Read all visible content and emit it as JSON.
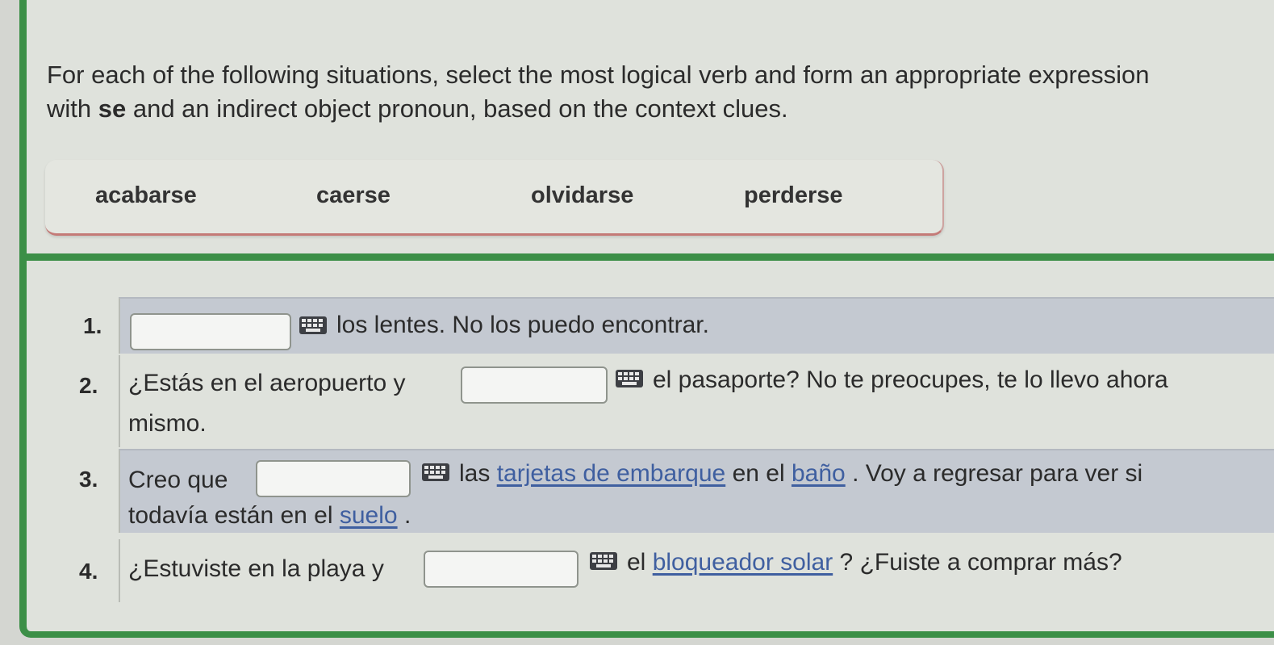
{
  "instructions": {
    "line1": "For each of the following situations, select the most logical verb and form an appropriate expression",
    "line2_pre": "with ",
    "line2_bold": "se",
    "line2_post": " and an indirect object pronoun, based on the context clues."
  },
  "word_bank": [
    "acabarse",
    "caerse",
    "olvidarse",
    "perderse"
  ],
  "questions": [
    {
      "number": "1.",
      "after": "los lentes. No los puedo encontrar.",
      "answer": ""
    },
    {
      "number": "2.",
      "before": "¿Estás en el aeropuerto y",
      "after": "el pasaporte? No te preocupes, te lo llevo ahora",
      "line2": "mismo.",
      "answer": ""
    },
    {
      "number": "3.",
      "before": "Creo que",
      "after_a": "las",
      "link_a": "tarjetas de embarque",
      "after_b": "en el",
      "link_b": "baño",
      "after_c": ". Voy a regresar para ver si",
      "line2_pre": "todavía están en el",
      "link_c": "suelo",
      "line2_post": ".",
      "answer": ""
    },
    {
      "number": "4.",
      "before": "¿Estuviste en la playa y",
      "after_a": "el",
      "link_a": "bloqueador solar",
      "after_b": "? ¿Fuiste a comprar más?",
      "answer": ""
    }
  ],
  "colors": {
    "accent_green": "#3c8f47",
    "row_shade": "#c4c9d1",
    "link": "#3f5fa0"
  }
}
